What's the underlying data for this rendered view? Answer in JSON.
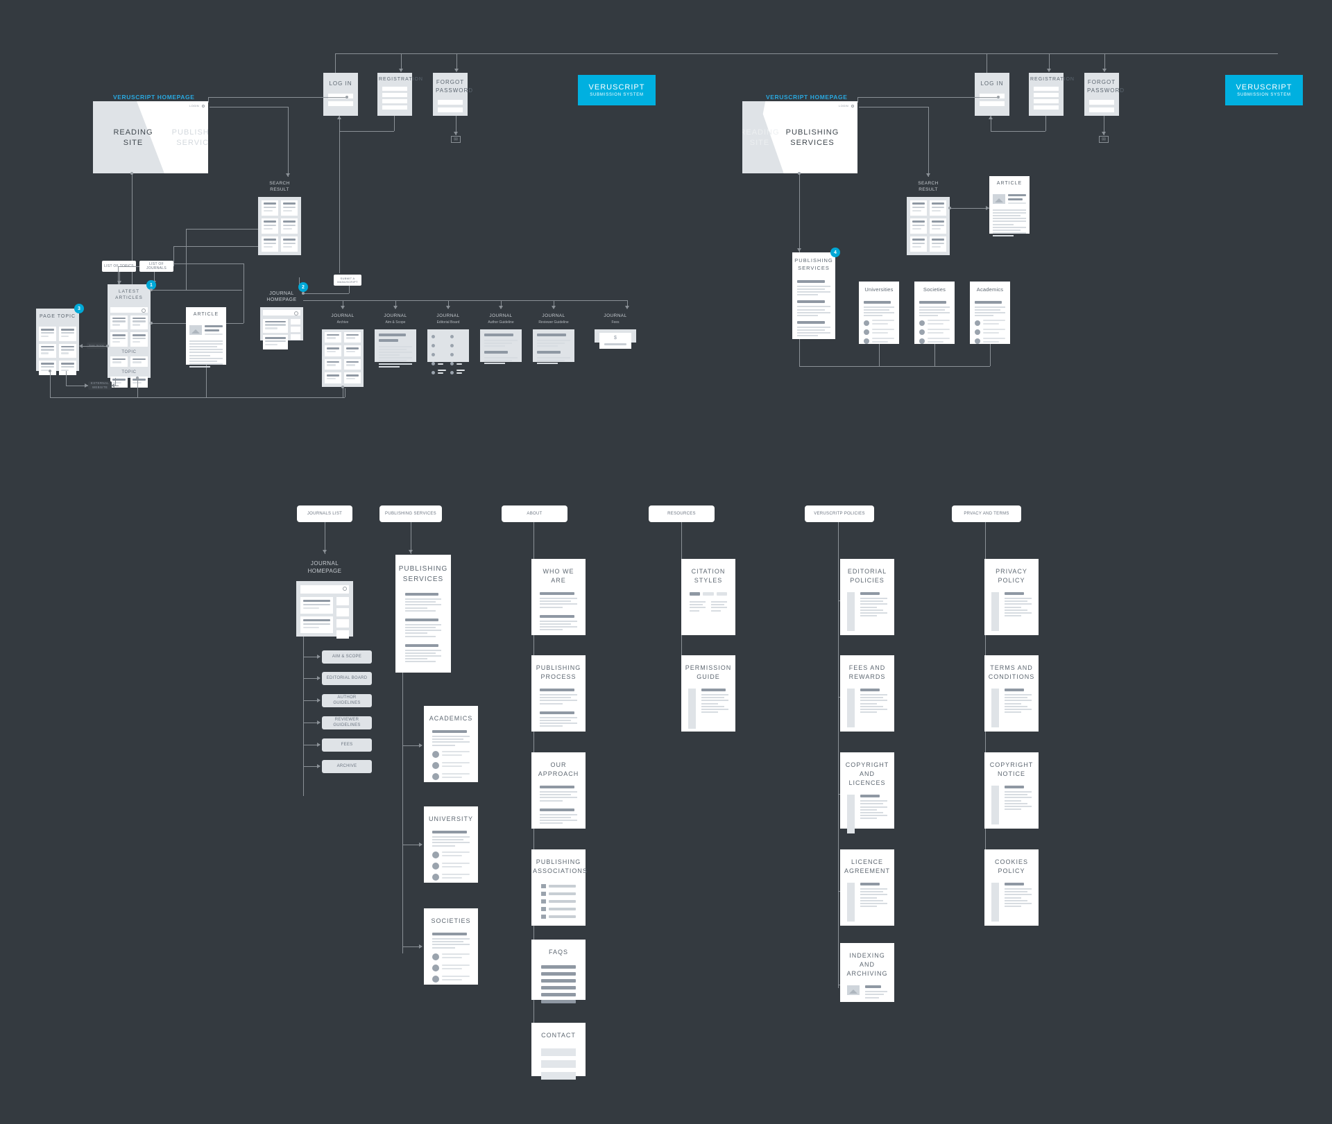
{
  "meta": {
    "background_color": "#343a40",
    "accent_color": "#00b0e0",
    "caption_color": "#29a8df",
    "card_color": "#ffffff",
    "card_grey": "#dfe3e7"
  },
  "cluster_reading": {
    "caption": "VERUSCRIPT HOMEPAGE",
    "hero": {
      "active": "READING SITE",
      "inactive": "PUBLISHING SERVICES",
      "login": "LOGIN"
    },
    "cta": {
      "line1": "VERUSCRIPT",
      "line2": "SUBMISSION SYSTEM"
    },
    "auth": [
      {
        "label": "LOG IN"
      },
      {
        "label": "REGISTRATION"
      },
      {
        "label": "FORGOT PASSWORD"
      }
    ],
    "mail_icon": "envelope-icon",
    "search_result": {
      "line1": "SEARCH",
      "line2": "RESULT"
    },
    "pills": [
      {
        "label": "LIST OF TOPICS"
      },
      {
        "label": "LIST OF JOURNALS"
      },
      {
        "label": "SUBMIT A MANUSCRIPT"
      },
      {
        "label": "See more"
      },
      {
        "label": "EXTERNAL WEBSITE"
      }
    ],
    "page_topic": {
      "title": "PAGE TOPIC",
      "badge": "3"
    },
    "latest_articles": {
      "title": "LATEST ARTICLES",
      "badge": "1",
      "topic1": "TOPIC",
      "topic2": "TOPIC"
    },
    "article": {
      "title": "ARTICLE"
    },
    "journal_homepage": {
      "line1": "JOURNAL",
      "line2": "HOMEPAGE",
      "badge": "2"
    },
    "journal_pages": [
      {
        "title": "JOURNAL",
        "sub": "Archive"
      },
      {
        "title": "JOURNAL",
        "sub": "Aim & Scope"
      },
      {
        "title": "JOURNAL",
        "sub": "Editorial Board"
      },
      {
        "title": "JOURNAL",
        "sub": "Author Guideline"
      },
      {
        "title": "JOURNAL",
        "sub": "Reviewer Guideline"
      },
      {
        "title": "JOURNAL",
        "sub": "Fees",
        "currency": "$"
      }
    ]
  },
  "cluster_publishing": {
    "caption": "VERUSCRIPT HOMEPAGE",
    "hero": {
      "active": "PUBLISHING SERVICES",
      "inactive": "READING SITE",
      "login": "LOGIN"
    },
    "cta": {
      "line1": "VERUSCRIPT",
      "line2": "SUBMISSION SYSTEM"
    },
    "auth": [
      {
        "label": "LOG IN"
      },
      {
        "label": "REGISTRATION"
      },
      {
        "label": "FORGOT PASSWORD"
      }
    ],
    "mail_icon": "envelope-icon",
    "search_result": {
      "line1": "SEARCH",
      "line2": "RESULT"
    },
    "article": {
      "title": "ARTICLE"
    },
    "publishing_services": {
      "line1": "PUBLISHING",
      "line2": "SERVICES",
      "badge": "4"
    },
    "audience_pages": [
      {
        "title": "Universities"
      },
      {
        "title": "Societies"
      },
      {
        "title": "Academics"
      }
    ]
  },
  "sitemap": {
    "sections": [
      {
        "label": "JOURNALS LIST"
      },
      {
        "label": "PUBLISHING SERVICES"
      },
      {
        "label": "ABOUT"
      },
      {
        "label": "RESOURCES"
      },
      {
        "label": "VERUSCRITP POLICIES"
      },
      {
        "label": "PRVACY AND TERMS"
      }
    ],
    "journals": {
      "root": {
        "line1": "JOURNAL",
        "line2": "HOMEPAGE"
      },
      "children": [
        {
          "label": "AIM & SCOPE"
        },
        {
          "label": "EDITORIAL BOARD"
        },
        {
          "label": "AUTHOR GUIDELINES"
        },
        {
          "label": "REVIEWER GUIDELINES"
        },
        {
          "label": "FEES"
        },
        {
          "label": "ARCHIVE"
        }
      ]
    },
    "publishing": [
      {
        "title": "PUBLISHING SERVICES",
        "kind": "article"
      },
      {
        "title": "ACADEMICS",
        "kind": "list"
      },
      {
        "title": "UNIVERSITY",
        "kind": "list"
      },
      {
        "title": "SOCIETIES",
        "kind": "list"
      }
    ],
    "about": [
      {
        "title": "WHO WE ARE",
        "kind": "article"
      },
      {
        "title": "PUBLISHING PROCESS",
        "kind": "article"
      },
      {
        "title": "OUR APPROACH",
        "kind": "article"
      },
      {
        "title": "PUBLISHING ASSOCIATIONS",
        "kind": "logos"
      },
      {
        "title": "FAQS",
        "kind": "faq"
      },
      {
        "title": "CONTACT",
        "kind": "form"
      }
    ],
    "resources": [
      {
        "title": "CITATION STYLES",
        "kind": "tabs"
      },
      {
        "title": "PERMISSION GUIDE",
        "kind": "sidebar"
      }
    ],
    "policies": [
      {
        "title": "EDITORIAL POLICIES",
        "kind": "sidebar"
      },
      {
        "title": "FEES AND REWARDS",
        "kind": "sidebar"
      },
      {
        "title": "COPYRIGHT AND LICENCES",
        "kind": "sidebar"
      },
      {
        "title": "LICENCE AGREEMENT",
        "kind": "sidebar"
      },
      {
        "title": "INDEXING AND ARCHIVING",
        "kind": "image"
      }
    ],
    "privacy": [
      {
        "title": "PRIVACY POLICY",
        "kind": "sidebar"
      },
      {
        "title": "TERMS AND CONDITIONS",
        "kind": "sidebar"
      },
      {
        "title": "COPYRIGHT NOTICE",
        "kind": "sidebar"
      },
      {
        "title": "COOKIES POLICY",
        "kind": "sidebar"
      }
    ]
  }
}
